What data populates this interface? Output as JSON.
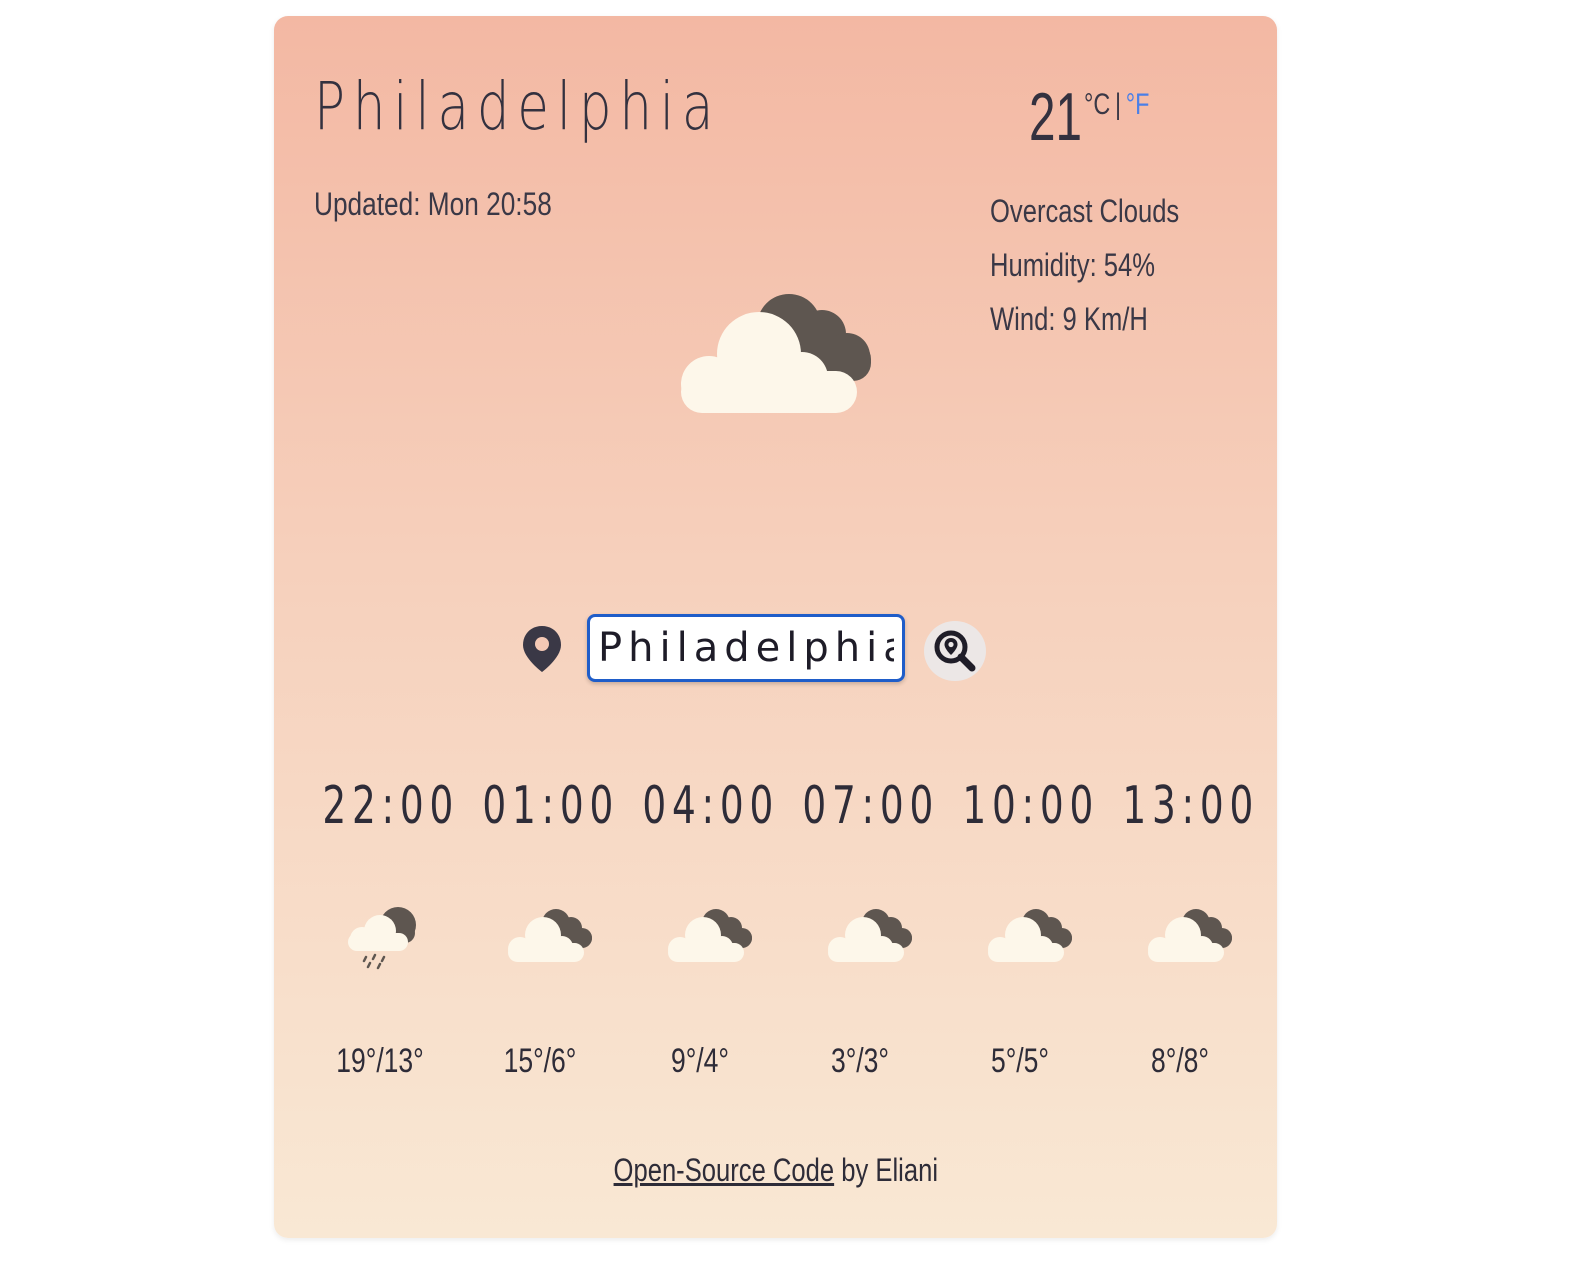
{
  "current": {
    "city": "Philadelphia",
    "updated": "Updated: Mon 20:58",
    "temperature": "21",
    "unit_c": "°C",
    "unit_separator": "|",
    "unit_f": "°F",
    "description": "Overcast Clouds",
    "humidity": "Humidity: 54%",
    "wind": "Wind: 9 Km/H",
    "icon": "overcast-clouds-icon"
  },
  "search": {
    "value": "Philadelphia"
  },
  "forecast": [
    {
      "time": "22:00",
      "temps": "19°/13°",
      "icon": "rain-clouds-icon"
    },
    {
      "time": "01:00",
      "temps": "15°/6°",
      "icon": "overcast-clouds-icon"
    },
    {
      "time": "04:00",
      "temps": "9°/4°",
      "icon": "overcast-clouds-icon"
    },
    {
      "time": "07:00",
      "temps": "3°/3°",
      "icon": "overcast-clouds-icon"
    },
    {
      "time": "10:00",
      "temps": "5°/5°",
      "icon": "overcast-clouds-icon"
    },
    {
      "time": "13:00",
      "temps": "8°/8°",
      "icon": "overcast-clouds-icon"
    }
  ],
  "footer": {
    "link_text": "Open-Source Code",
    "suffix": " by Eliani"
  },
  "colors": {
    "card_top": "#f3b8a3",
    "card_bottom": "#f9e8d4",
    "text": "#33313f",
    "unit_active": "#4a7fe8",
    "input_border": "#1f5dc9",
    "cloud_light": "#fdf7ea",
    "cloud_dark": "#5e5650"
  }
}
